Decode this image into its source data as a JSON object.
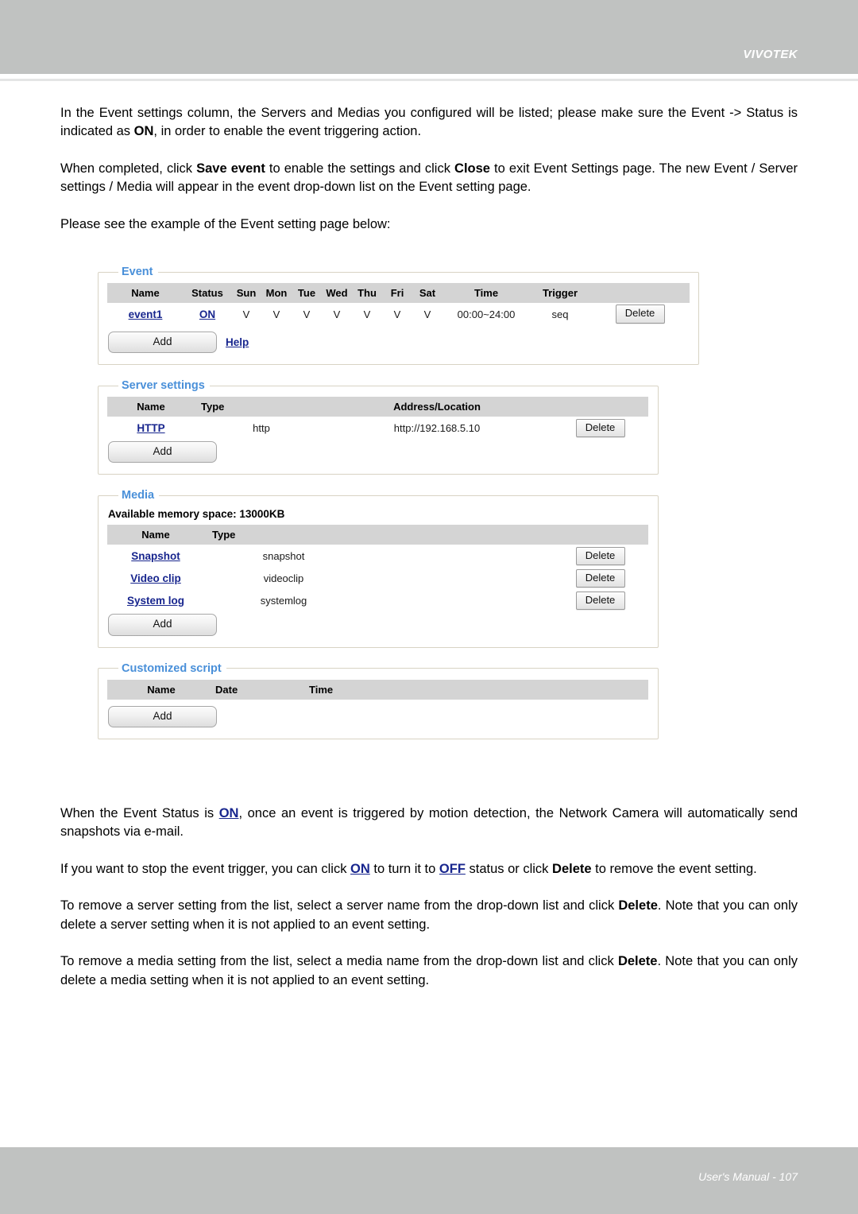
{
  "header": {
    "brand": "VIVOTEK"
  },
  "body_text": {
    "p1_part1": "In the Event settings column, the Servers and Medias you configured will be listed; please make sure the Event -> Status is indicated as ",
    "p1_bold": "ON",
    "p1_part2": ", in order to enable the event triggering action.",
    "p2_part1": "When completed, click ",
    "p2_bold1": "Save event",
    "p2_part2": " to enable the settings and click ",
    "p2_bold2": "Close",
    "p2_part3": " to exit Event Settings page. The new Event / Server settings / Media will appear in the event drop-down list on the Event setting page.",
    "p3": "Please see the example of the Event setting page below:",
    "p4_part1": "When the Event Status is ",
    "p4_link": "ON",
    "p4_part2": ", once an event is triggered by motion detection, the Network Camera will automatically send snapshots via e-mail.",
    "p5_part1": "If you want to stop the event trigger, you can click ",
    "p5_link1": "ON",
    "p5_part2": " to turn it to ",
    "p5_link2": "OFF",
    "p5_part3": " status or click ",
    "p5_bold": "Delete",
    "p5_part4": " to remove the event setting.",
    "p6_part1": "To remove a server setting from the list, select a server name from the drop-down list and click ",
    "p6_bold": "Delete",
    "p6_part2": ". Note that you can only delete a server setting when it is not applied to an event setting.",
    "p7_part1": "To remove a media setting from the list, select a media name from the drop-down list and click ",
    "p7_bold": "Delete",
    "p7_part2": ". Note that you can only delete a media setting when it is not applied to an event setting."
  },
  "event_panel": {
    "legend": "Event",
    "headers": [
      "Name",
      "Status",
      "Sun",
      "Mon",
      "Tue",
      "Wed",
      "Thu",
      "Fri",
      "Sat",
      "Time",
      "Trigger",
      ""
    ],
    "rows": [
      {
        "name": "event1",
        "status": "ON",
        "sun": "V",
        "mon": "V",
        "tue": "V",
        "wed": "V",
        "thu": "V",
        "fri": "V",
        "sat": "V",
        "time": "00:00~24:00",
        "trigger": "seq",
        "delete_label": "Delete"
      }
    ],
    "add_label": "Add",
    "help_label": "Help"
  },
  "server_panel": {
    "legend": "Server settings",
    "headers": [
      "Name",
      "Type",
      "Address/Location",
      ""
    ],
    "rows": [
      {
        "name": "HTTP",
        "type": "http",
        "address": "http://192.168.5.10",
        "delete_label": "Delete"
      }
    ],
    "add_label": "Add"
  },
  "media_panel": {
    "legend": "Media",
    "memory_line": "Available memory space: 13000KB",
    "headers": [
      "Name",
      "Type",
      "",
      ""
    ],
    "rows": [
      {
        "name": "Snapshot",
        "type": "snapshot",
        "delete_label": "Delete"
      },
      {
        "name": "Video clip",
        "type": "videoclip",
        "delete_label": "Delete"
      },
      {
        "name": "System log",
        "type": "systemlog",
        "delete_label": "Delete"
      }
    ],
    "add_label": "Add"
  },
  "script_panel": {
    "legend": "Customized script",
    "headers": [
      "Name",
      "Date",
      "Time",
      ""
    ],
    "rows": [],
    "add_label": "Add"
  },
  "footer": {
    "text": "User's Manual - 107"
  },
  "colors": {
    "chrome_gray": "#c0c2c1",
    "legend_blue": "#4a90d9",
    "link_navy": "#18268e",
    "table_header_gray": "#d4d4d4"
  }
}
